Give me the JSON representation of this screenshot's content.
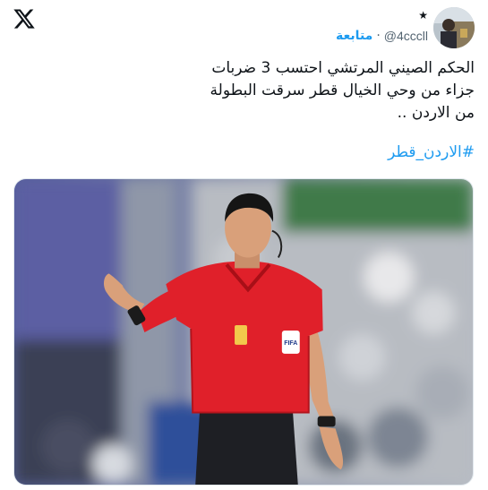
{
  "header": {
    "star": "★",
    "handle": "@4cccll",
    "separator": "·",
    "follow_label": "متابعة"
  },
  "icons": {
    "platform": "x-logo-icon",
    "badge": "star-icon"
  },
  "tweet": {
    "lines": [
      "الحكم الصيني المرتشي احتسب 3 ضربات",
      "جزاء من وحي الخيال قطر سرقت البطولة",
      "من الاردن .."
    ],
    "hashtag": "#الاردن_قطر"
  },
  "photo": {
    "shirt_badge_text": "FIFA"
  },
  "colors": {
    "accent": "#1d9bf0",
    "text": "#0f1419",
    "muted": "#536471",
    "referee_shirt": "#e0202a"
  }
}
